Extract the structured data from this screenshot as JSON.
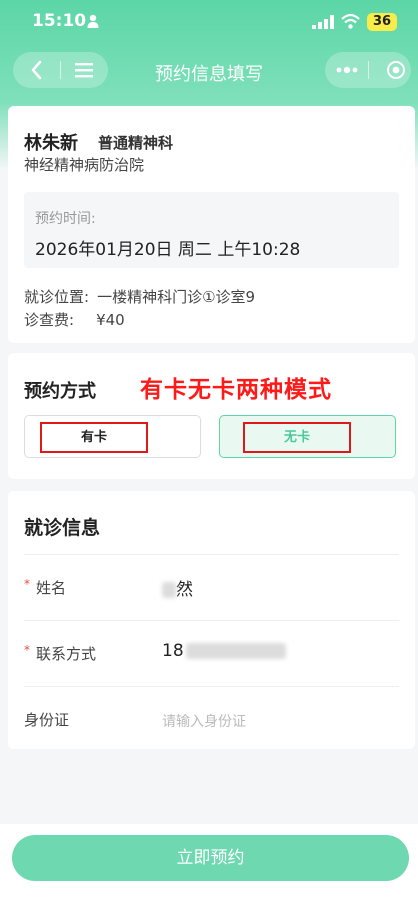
{
  "status_bar": {
    "time": "15:10",
    "battery": "36"
  },
  "nav": {
    "title": "预约信息填写"
  },
  "appointment": {
    "doctor_name": "林朱新",
    "department": "普通精神科",
    "hospital": "神经精神病防治院",
    "time_label": "预约时间:",
    "time_value": "2026年01月20日 周二 上午10:28",
    "location_label": "就诊位置:",
    "location_value": "一楼精神科门诊①诊室9",
    "fee_label": "诊查费:",
    "fee_value": "¥40"
  },
  "booking_method": {
    "title": "预约方式",
    "annotation": "有卡无卡两种模式",
    "options": [
      "有卡",
      "无卡"
    ],
    "selected": "无卡"
  },
  "visit_info": {
    "title": "就诊信息",
    "required_mark": "*",
    "name_label": "姓名",
    "name_value_visible": "然",
    "contact_label": "联系方式",
    "contact_value_visible": "18",
    "id_label": "身份证",
    "id_placeholder": "请输入身份证"
  },
  "submit_label": "立即预约",
  "colors": {
    "accent": "#5cd6a6",
    "annotation_red": "#e01818"
  }
}
